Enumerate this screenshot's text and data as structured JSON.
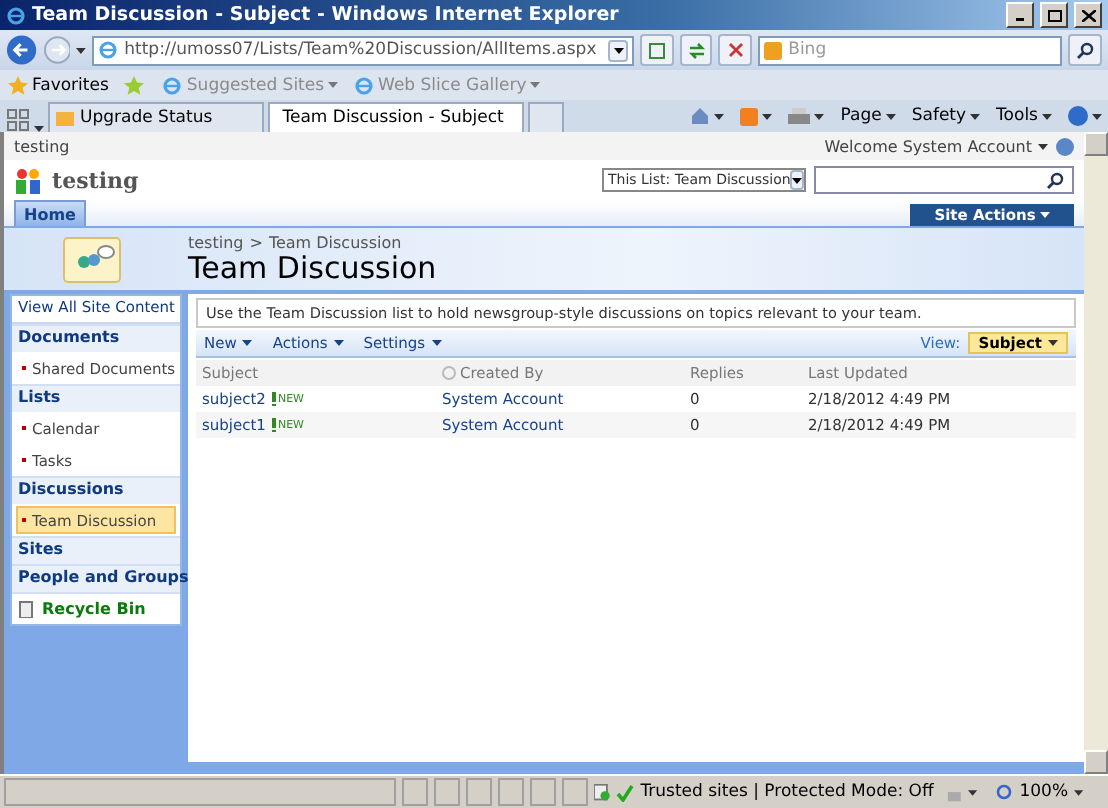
{
  "window": {
    "title": "Team Discussion - Subject - Windows Internet Explorer"
  },
  "address_bar": {
    "url": "http://umoss07/Lists/Team%20Discussion/AllItems.aspx"
  },
  "search_box": {
    "placeholder": "Bing"
  },
  "favorites_bar": {
    "label": "Favorites",
    "items": [
      "Suggested Sites",
      "Web Slice Gallery"
    ]
  },
  "browser_tabs": [
    {
      "label": "Upgrade Status",
      "selected": false
    },
    {
      "label": "Team Discussion - Subject",
      "selected": true
    }
  ],
  "command_bar": [
    "Page",
    "Safety",
    "Tools"
  ],
  "site": {
    "crumb": "testing",
    "welcome": "Welcome System Account",
    "title": "testing",
    "search_scope": "This List: Team Discussion",
    "site_actions": "Site Actions",
    "top_nav": [
      {
        "label": "Home",
        "selected": true
      }
    ],
    "breadcrumb": [
      "testing",
      ">",
      "Team Discussion"
    ],
    "page_title": "Team Discussion"
  },
  "quick_launch": [
    {
      "kind": "link",
      "label": "View All Site Content"
    },
    {
      "kind": "heading",
      "label": "Documents"
    },
    {
      "kind": "item",
      "label": "Shared Documents",
      "selected": false
    },
    {
      "kind": "heading",
      "label": "Lists"
    },
    {
      "kind": "item",
      "label": "Calendar",
      "selected": false
    },
    {
      "kind": "item",
      "label": "Tasks",
      "selected": false
    },
    {
      "kind": "heading",
      "label": "Discussions"
    },
    {
      "kind": "item",
      "label": "Team Discussion",
      "selected": true
    },
    {
      "kind": "heading",
      "label": "Sites"
    },
    {
      "kind": "heading",
      "label": "People and Groups"
    },
    {
      "kind": "recycle",
      "label": "Recycle Bin"
    }
  ],
  "description": "Use the Team Discussion list to hold newsgroup-style discussions on topics relevant to your team.",
  "toolbar": [
    "New",
    "Actions",
    "Settings"
  ],
  "view": {
    "label": "View:",
    "value": "Subject"
  },
  "table": {
    "columns": [
      "Subject",
      "Created By",
      "Replies",
      "Last Updated"
    ],
    "rows": [
      {
        "subject": "subject2",
        "badge": "NEW",
        "created_by": "System Account",
        "replies": "0",
        "updated": "2/18/2012 4:49 PM"
      },
      {
        "subject": "subject1",
        "badge": "NEW",
        "created_by": "System Account",
        "replies": "0",
        "updated": "2/18/2012 4:49 PM"
      }
    ]
  },
  "status_bar": {
    "zone": "Trusted sites | Protected Mode: Off",
    "zoom": "100%"
  }
}
